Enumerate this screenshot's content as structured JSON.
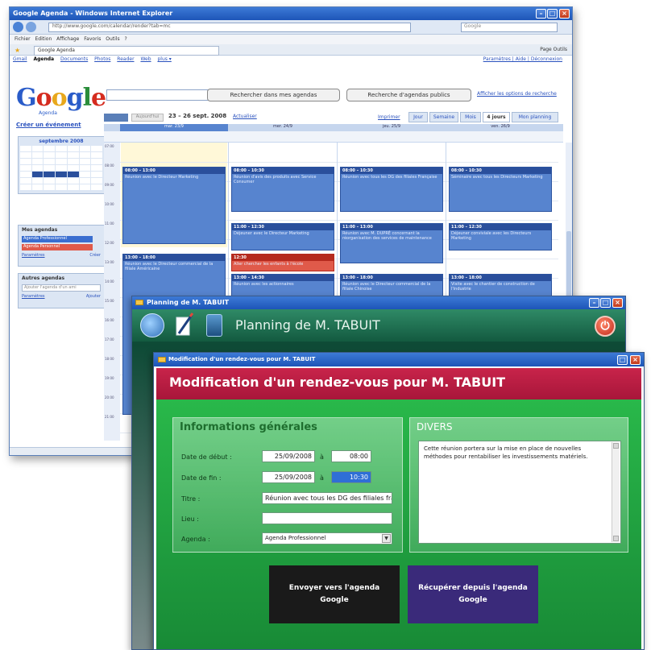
{
  "browser": {
    "title": "Google Agenda - Windows Internet Explorer",
    "url": "http://www.google.com/calendar/render?tab=mc",
    "search_placeholder": "Google",
    "menu": "Fichier  Edition  Affichage  Favoris  Outils  ?",
    "tab_label": "Google Agenda",
    "tools": "Page  Outils"
  },
  "gnav": {
    "links": [
      "Gmail",
      "Agenda",
      "Documents",
      "Photos",
      "Reader",
      "Web",
      "plus ▾"
    ],
    "right": "Paramètres | Aide | Déconnexion"
  },
  "google": {
    "logo_parts": [
      "G",
      "o",
      "o",
      "g",
      "l",
      "e"
    ],
    "logo_sub": "Agenda",
    "search_my_btn": "Rechercher dans mes agendas",
    "search_public_btn": "Recherche d'agendas publics",
    "show_options": "Afficher les options de recherche"
  },
  "sidebar": {
    "create_link": "Créer un événement",
    "minical_title": "septembre 2008",
    "my_agendas": "Mes agendas",
    "agendas": [
      {
        "label": "Agenda Professionnel",
        "color": "#3a6ed0"
      },
      {
        "label": "Agenda Personnel",
        "color": "#e05a4a"
      }
    ],
    "settings_link": "Paramètres",
    "add_link": "Créer",
    "other_agendas": "Autres agendas",
    "add_friend_placeholder": "Ajouter l'agenda d'un ami",
    "settings_link2": "Paramètres",
    "add_link2": "Ajouter"
  },
  "calendar": {
    "today_btn": "Aujourd'hui",
    "range": "23 – 26 sept. 2008",
    "refresh": "Actualiser",
    "print": "Imprimer",
    "views": [
      "Jour",
      "Semaine",
      "Mois",
      "4 jours",
      "Mon planning"
    ],
    "active_view": "4 jours",
    "days": [
      "mar. 23/9",
      "mer. 24/9",
      "jeu. 25/9",
      "ven. 26/9"
    ],
    "hours": [
      "07:00",
      "08:00",
      "09:00",
      "10:00",
      "11:00",
      "12:00",
      "13:00",
      "14:00",
      "15:00",
      "16:00",
      "17:00",
      "18:00",
      "19:00",
      "20:00",
      "21:00"
    ]
  },
  "events": [
    {
      "time": "08:00 – 13:00",
      "title": "Réunion avec le Directeur Marketing",
      "color": "#5784cf"
    },
    {
      "time": "08:00 – 10:30",
      "title": "Réunion d'avis des produits avec Service Consumer",
      "color": "#5784cf"
    },
    {
      "time": "08:00 – 10:30",
      "title": "Réunion avec tous les DG des filiales Française",
      "color": "#5784cf"
    },
    {
      "time": "08:00 – 10:30",
      "title": "Séminaire avec tous les Directeurs Marketing",
      "color": "#5784cf"
    },
    {
      "time": "11:00 – 12:30",
      "title": "Déjeuner avec le Directeur Marketing",
      "color": "#5784cf"
    },
    {
      "time": "11:00 – 13:00",
      "title": "Réunion avec M. DUPRÉ concernant la réorganisation des services de maintenance",
      "color": "#5784cf"
    },
    {
      "time": "11:00 – 12:30",
      "title": "Déjeuner conviviale avec les Directeurs Marketing",
      "color": "#5784cf"
    },
    {
      "time": "12:30",
      "title": "Aller chercher les enfants à l'école",
      "color": "#e05a4a"
    },
    {
      "time": "13:00 – 18:00",
      "title": "Réunion avec le Directeur commercial de la filiale Américaine",
      "color": "#5784cf"
    },
    {
      "time": "13:00 – 14:30",
      "title": "Réunion avec les actionnaires",
      "color": "#5784cf"
    },
    {
      "time": "13:00 – 18:00",
      "title": "Réunion avec le Directeur commercial de la filiale Chinoise",
      "color": "#5784cf"
    },
    {
      "time": "13:00 – 18:00",
      "title": "Visite avec le chantier de construction de l'industrie",
      "color": "#5784cf"
    }
  ],
  "planning": {
    "window_title": "Planning de M. TABUIT",
    "header_title": "Planning de M. TABUIT",
    "power_symbol": "⏻"
  },
  "dialog": {
    "window_title": "Modification d'un rendez-vous pour M. TABUIT",
    "header": "Modification d'un rendez-vous pour M. TABUIT",
    "info_title": "Informations générales",
    "labels": {
      "start": "Date de début :",
      "end": "Date de fin :",
      "title": "Titre :",
      "place": "Lieu :",
      "agenda": "Agenda :"
    },
    "amp": "à",
    "start_date": "25/09/2008",
    "start_time": "08:00",
    "end_date": "25/09/2008",
    "end_time": "10:30",
    "title_value": "Réunion avec tous les DG des filiales française",
    "place_value": "",
    "agenda_value": "Agenda Professionnel",
    "divers_title": "DIVERS",
    "divers_text": "Cette réunion portera sur la mise en place de nouvelles méthodes pour rentabiliser les investissements matériels.",
    "btn_send": "Envoyer vers l'agenda Google",
    "btn_fetch": "Récupérer depuis l'agenda Google"
  }
}
